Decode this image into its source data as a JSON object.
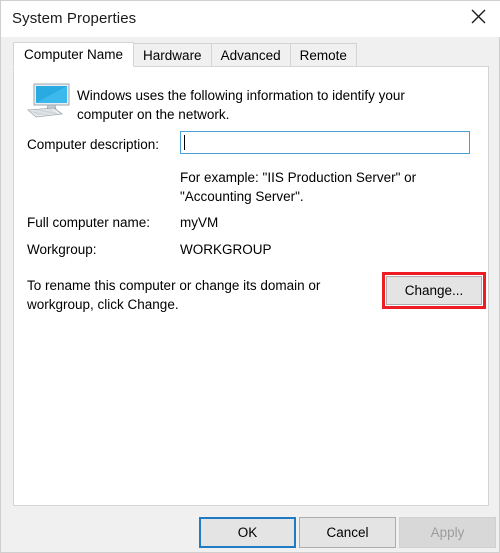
{
  "window": {
    "title": "System Properties",
    "close_icon": "close-icon"
  },
  "tabs": [
    {
      "label": "Computer Name",
      "active": true
    },
    {
      "label": "Hardware",
      "active": false
    },
    {
      "label": "Advanced",
      "active": false
    },
    {
      "label": "Remote",
      "active": false
    }
  ],
  "panel": {
    "icon_name": "computer-monitor-icon",
    "intro_text": "Windows uses the following information to identify your computer on the network.",
    "description": {
      "label": "Computer description:",
      "value": "",
      "placeholder": "",
      "example_text": "For example: \"IIS Production Server\" or \"Accounting Server\"."
    },
    "full_computer_name": {
      "label": "Full computer name:",
      "value": "myVM"
    },
    "workgroup": {
      "label": "Workgroup:",
      "value": "WORKGROUP"
    },
    "rename_text": "To rename this computer or change its domain or workgroup, click Change.",
    "change_button": "Change..."
  },
  "footer": {
    "ok_label": "OK",
    "cancel_label": "Cancel",
    "apply_label": "Apply"
  },
  "colors": {
    "highlight": "#ee1c25",
    "focus_border": "#1f7cc4",
    "input_border": "#4b9ed4",
    "window_bg": "#f0f0f0",
    "panel_bg": "#ffffff"
  }
}
